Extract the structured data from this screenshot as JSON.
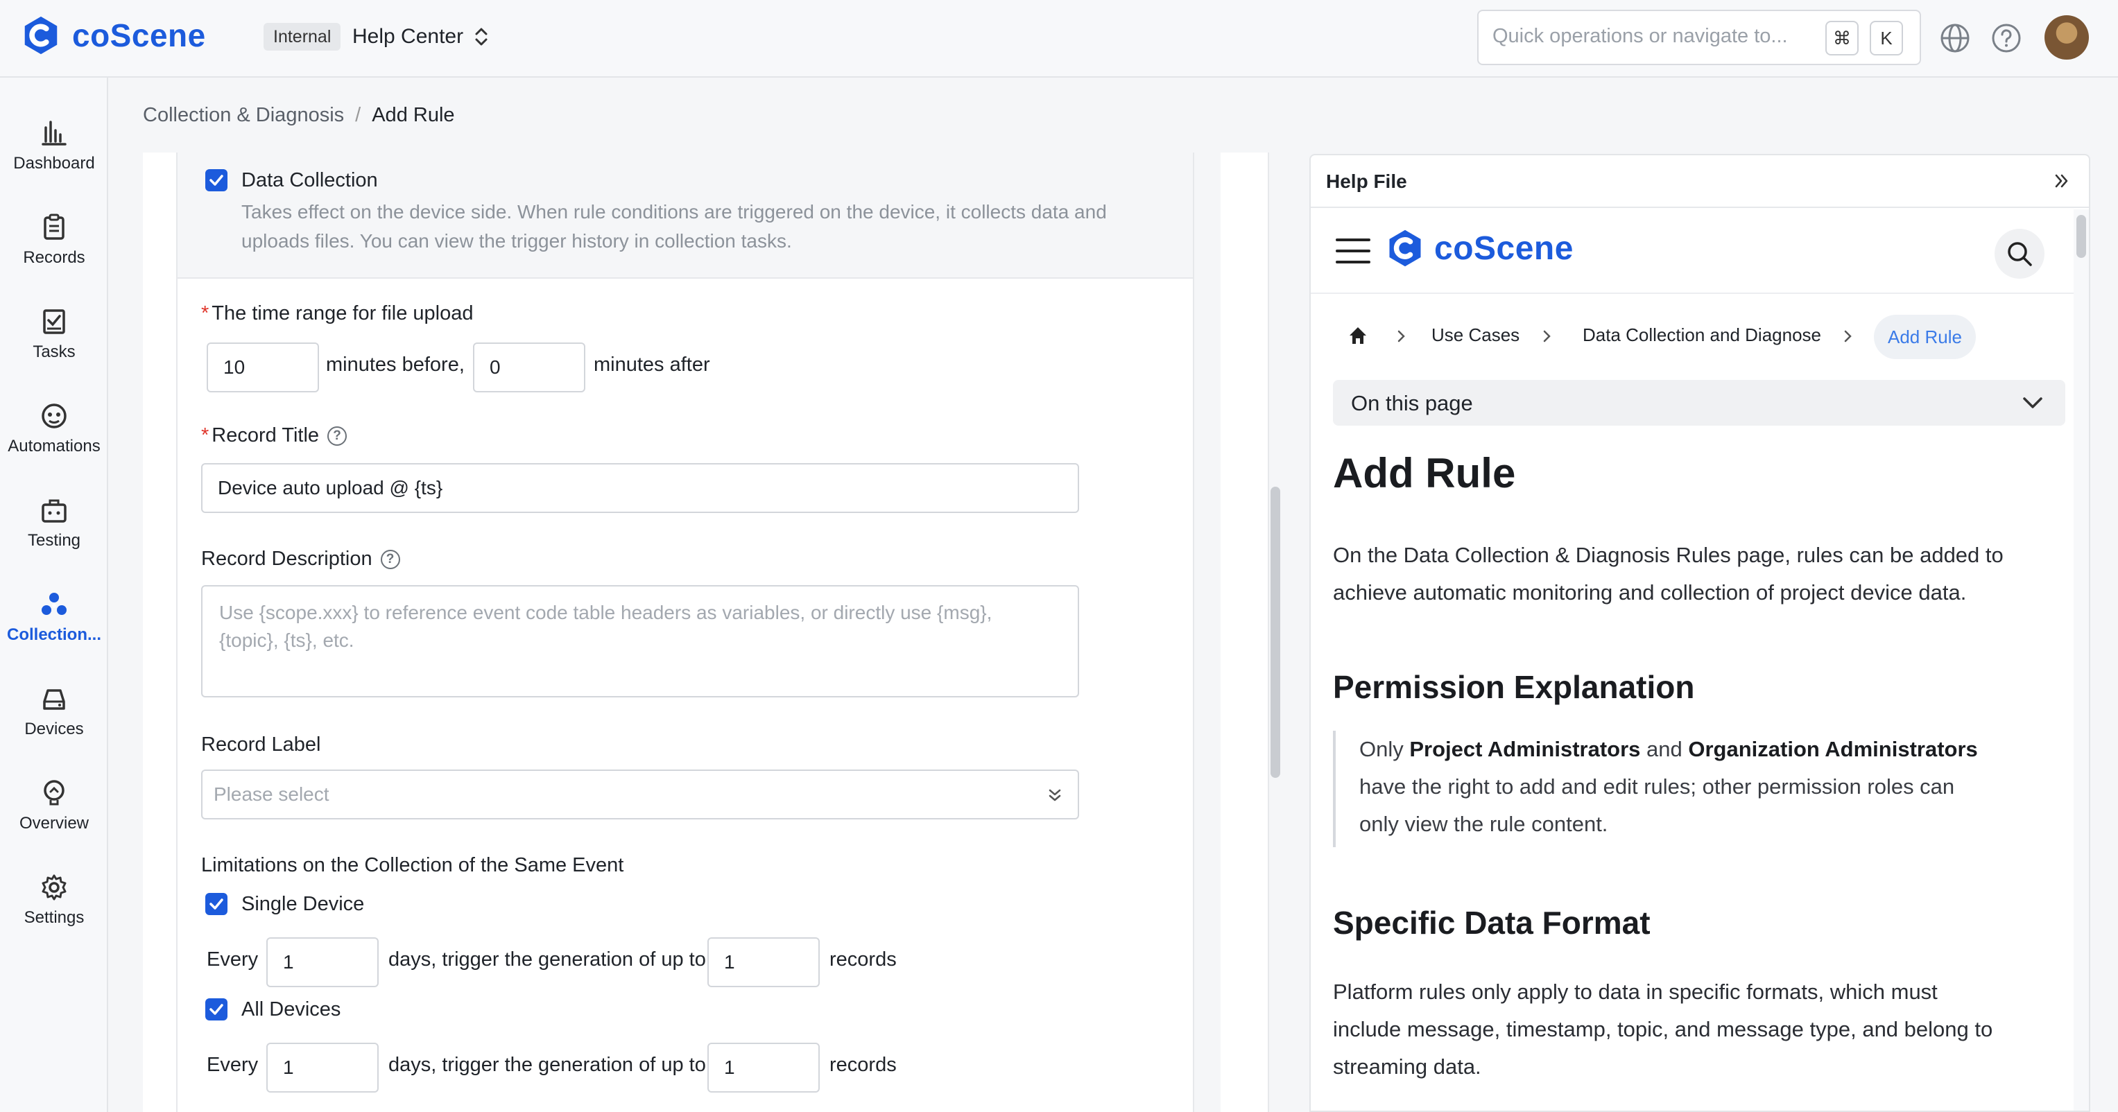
{
  "header": {
    "logo_text": "coScene",
    "env_badge": "Internal",
    "project_name": "Help Center",
    "search_placeholder": "Quick operations or navigate to...",
    "shortcut_keys": [
      "⌘",
      "K"
    ],
    "icons": [
      "globe-icon",
      "help-icon",
      "avatar"
    ]
  },
  "sidebar": {
    "items": [
      {
        "label": "Dashboard",
        "icon": "bar-chart-icon"
      },
      {
        "label": "Records",
        "icon": "clipboard-icon"
      },
      {
        "label": "Tasks",
        "icon": "task-check-icon"
      },
      {
        "label": "Automations",
        "icon": "robot-icon"
      },
      {
        "label": "Testing",
        "icon": "test-kit-icon"
      },
      {
        "label": "Collection...",
        "icon": "collection-icon",
        "active": true
      },
      {
        "label": "Devices",
        "icon": "device-icon"
      },
      {
        "label": "Overview",
        "icon": "overview-icon"
      },
      {
        "label": "Settings",
        "icon": "gear-icon"
      }
    ]
  },
  "breadcrumb": {
    "parent": "Collection & Diagnosis",
    "separator": "/",
    "current": "Add Rule"
  },
  "form": {
    "data_collection": {
      "checked": true,
      "label": "Data Collection",
      "desc_line1": "Takes effect on the device side. When rule conditions are triggered on the device, it collects data and",
      "desc_line2": "uploads files. You can view the trigger history in collection tasks."
    },
    "time_range": {
      "required_mark": "*",
      "label": "The time range for file upload",
      "before_value": "10",
      "before_text": "minutes before,",
      "after_value": "0",
      "after_text": "minutes after"
    },
    "record_title": {
      "required_mark": "*",
      "label": "Record Title",
      "help": "?",
      "value": "Device auto upload @ {ts}"
    },
    "record_description": {
      "label": "Record Description",
      "help": "?",
      "placeholder_line1": "Use {scope.xxx} to reference event code table headers as variables, or directly use {msg},",
      "placeholder_line2": "{topic}, {ts}, etc."
    },
    "record_label": {
      "label": "Record Label",
      "placeholder": "Please select"
    },
    "limitations": {
      "label": "Limitations on the Collection of the Same Event",
      "single_device": {
        "checked": true,
        "label": "Single Device",
        "every_text": "Every",
        "days_value": "1",
        "mid_text": "days, trigger the generation of up to",
        "records_value": "1",
        "records_text": "records"
      },
      "all_devices": {
        "checked": true,
        "label": "All Devices",
        "every_text": "Every",
        "days_value": "1",
        "mid_text": "days, trigger the generation of up to",
        "records_value": "1",
        "records_text": "records"
      }
    }
  },
  "help_panel": {
    "title": "Help File",
    "doc_logo": "coScene",
    "doc_breadcrumb": [
      "Use Cases",
      "Data Collection and Diagnose",
      "Add Rule"
    ],
    "on_this_page": "On this page",
    "h1": "Add Rule",
    "intro_line1": "On the Data Collection & Diagnosis Rules page, rules can be added to",
    "intro_line2": "achieve automatic monitoring and collection of project device data.",
    "h2_permission": "Permission Explanation",
    "quote_pre": "Only ",
    "quote_b1": "Project Administrators",
    "quote_mid": " and ",
    "quote_b2": "Organization Administrators",
    "quote_line2": "have the right to add and edit rules; other permission roles can",
    "quote_line3": "only view the rule content.",
    "h2_format": "Specific Data Format",
    "format_line1": "Platform rules only apply to data in specific formats, which must",
    "format_line2": "include message, timestamp, topic, and message type, and belong to",
    "format_line3": "streaming data."
  },
  "colors": {
    "brand": "#1c5bdc",
    "required": "#e0352b",
    "link": "#3b7be8"
  }
}
